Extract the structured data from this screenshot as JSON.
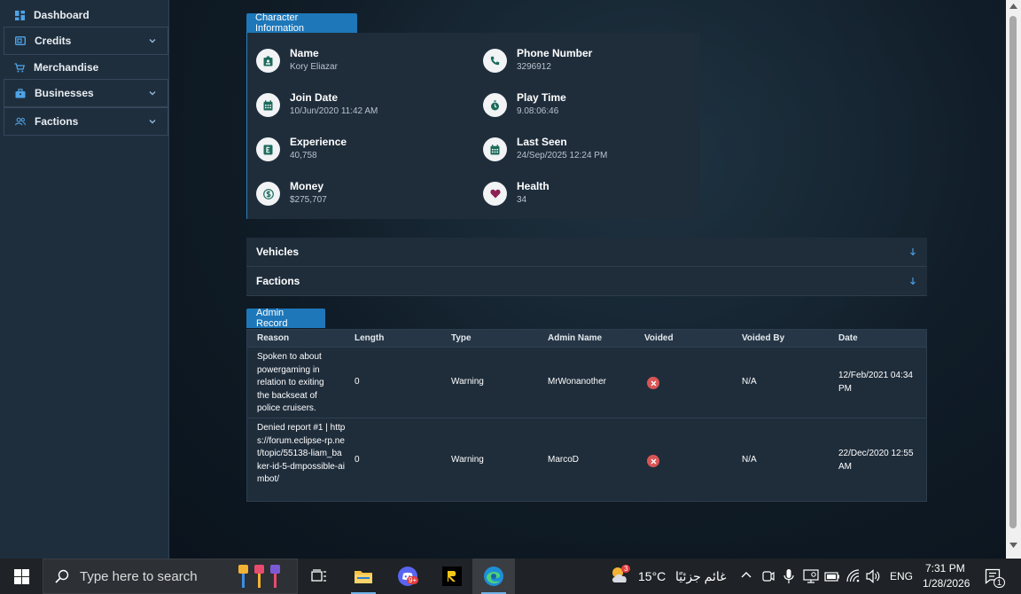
{
  "sidebar": {
    "items": [
      {
        "label": "Dashboard",
        "icon": "dashboard-icon"
      },
      {
        "label": "Credits",
        "icon": "credit-card-icon"
      },
      {
        "label": "Merchandise",
        "icon": "cart-icon"
      },
      {
        "label": "Businesses",
        "icon": "briefcase-icon"
      },
      {
        "label": "Factions",
        "icon": "users-icon"
      }
    ]
  },
  "character": {
    "section_title": "Character Information",
    "fields": [
      {
        "label": "Name",
        "value": "Kory Eliazar",
        "icon": "id-badge-icon"
      },
      {
        "label": "Phone Number",
        "value": "3296912",
        "icon": "phone-icon"
      },
      {
        "label": "Join Date",
        "value": "10/Jun/2020 11:42 AM",
        "icon": "calendar-icon"
      },
      {
        "label": "Play Time",
        "value": "9.08:06:46",
        "icon": "stopwatch-icon"
      },
      {
        "label": "Experience",
        "value": "40,758",
        "icon": "experience-icon"
      },
      {
        "label": "Last Seen",
        "value": "24/Sep/2025 12:24 PM",
        "icon": "calendar-icon"
      },
      {
        "label": "Money",
        "value": "$275,707",
        "icon": "dollar-icon"
      },
      {
        "label": "Health",
        "value": "34",
        "icon": "heart-icon"
      }
    ]
  },
  "accordions": {
    "vehicles": "Vehicles",
    "factions": "Factions"
  },
  "admin": {
    "section_title": "Admin Record",
    "columns": [
      "Reason",
      "Length",
      "Type",
      "Admin Name",
      "Voided",
      "Voided By",
      "Date"
    ],
    "rows": [
      {
        "reason": "Spoken to about powergaming in relation to exiting the backseat of police cruisers.",
        "length": "0",
        "type": "Warning",
        "admin": "MrWonanother",
        "voided": "no",
        "voided_by": "N/A",
        "date": "12/Feb/2021 04:34 PM"
      },
      {
        "reason": "Denied report #1 | https://forum.eclipse-rp.net/topic/55138-liam_baker-id-5-dmpossible-aimbot/",
        "length": "0",
        "type": "Warning",
        "admin": "MarcoD",
        "voided": "no",
        "voided_by": "N/A",
        "date": "22/Dec/2020 12:55 AM"
      }
    ]
  },
  "taskbar": {
    "search_placeholder": "Type here to search",
    "weather_temp": "15°C",
    "weather_text": "غائم جزئيًا",
    "weather_badge": "3",
    "discord_badge": "9+",
    "language": "ENG",
    "time": "7:31 PM",
    "date": "1/28/2026",
    "notification_count": "1"
  },
  "colors": {
    "accent": "#1e77b9",
    "sidebar_bg": "#1f2e3d",
    "card_bg": "#1f2d3b",
    "error": "#d95555",
    "heart": "#8b2252"
  }
}
